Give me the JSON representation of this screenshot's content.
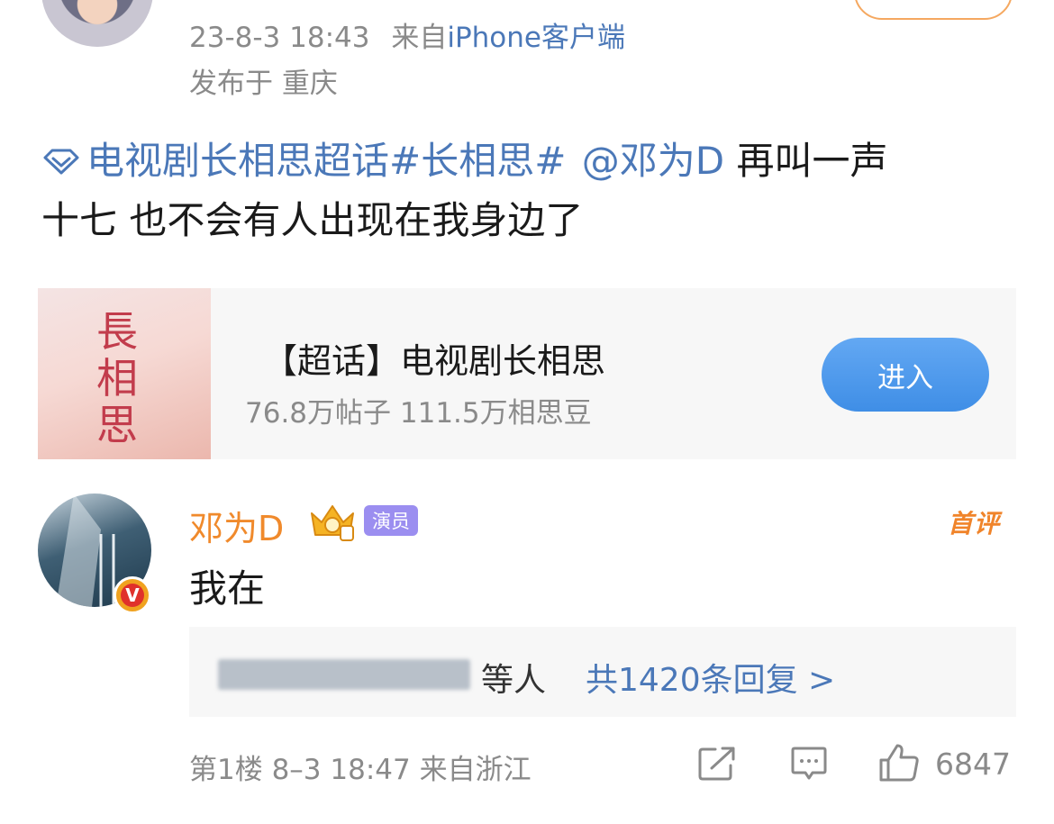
{
  "post": {
    "timestamp": "23-8-3 18:43",
    "source_prefix": "来自",
    "source": "iPhone客户端",
    "location": "发布于 重庆",
    "body": {
      "topic_link": "电视剧长相思超话",
      "hashtag": "#长相思#",
      "mention": "@邓为D",
      "text_line1": " 再叫一声",
      "text_line2": "十七 也不会有人出现在我身边了"
    }
  },
  "topic_card": {
    "cover_text": "長相思",
    "title": "【超话】电视剧长相思",
    "stats": "76.8万帖子 111.5万相思豆",
    "enter_label": "进入"
  },
  "comment": {
    "author": "邓为D",
    "role_badge": "演员",
    "first_badge": "首评",
    "text": "我在",
    "replies_suffix": "等人",
    "replies_count": "共1420条回复 >",
    "floor_meta": "第1楼 8–3 18:47 来自浙江",
    "like_count": "6847"
  },
  "colors": {
    "link": "#4b78b8",
    "author": "#f08a2c",
    "enter_button": "#3f8ee6",
    "role_badge": "#9b8ef0",
    "meta_text": "#8a8a8a"
  },
  "icons": [
    "diamond-icon",
    "crown-icon",
    "verified-v-icon",
    "share-icon",
    "comment-icon",
    "like-icon"
  ]
}
